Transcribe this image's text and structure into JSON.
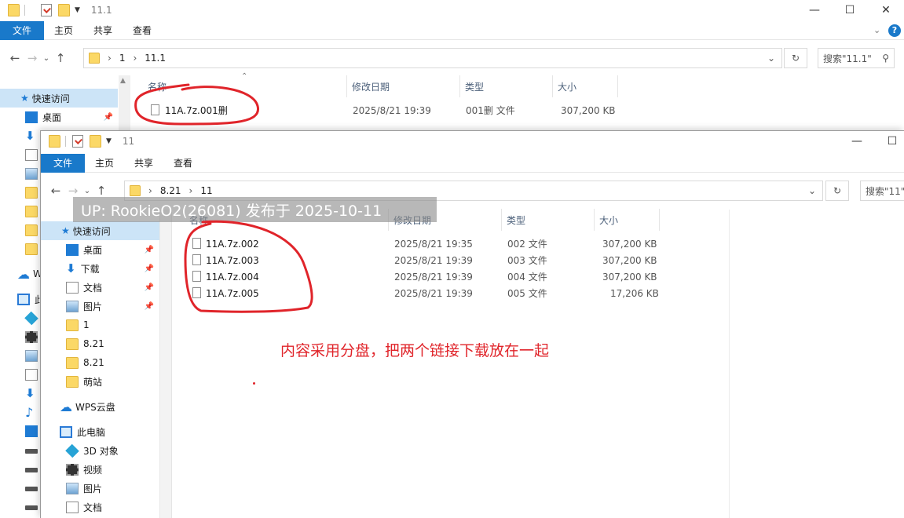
{
  "back_window": {
    "title": "11.1",
    "ribbon_tabs": [
      "文件",
      "主页",
      "共享",
      "查看"
    ],
    "path": [
      "1",
      "11.1"
    ],
    "search_placeholder": "搜索\"11.1\"",
    "columns": {
      "name": "名称",
      "modified": "修改日期",
      "type": "类型",
      "size": "大小"
    },
    "files": [
      {
        "name": "11A.7z.001删",
        "modified": "2025/8/21 19:39",
        "type": "001删 文件",
        "size": "307,200 KB"
      }
    ],
    "sidebar": {
      "quick_access": "快速访问",
      "desktop": "桌面",
      "wps": "W",
      "this_pc": "此"
    }
  },
  "front_window": {
    "title": "11",
    "ribbon_tabs": [
      "文件",
      "主页",
      "共享",
      "查看"
    ],
    "path": [
      "8.21",
      "11"
    ],
    "search_placeholder": "搜索\"11\"",
    "columns": {
      "name": "名称",
      "modified": "修改日期",
      "type": "类型",
      "size": "大小"
    },
    "files": [
      {
        "name": "11A.7z.002",
        "modified": "2025/8/21 19:35",
        "type": "002 文件",
        "size": "307,200 KB"
      },
      {
        "name": "11A.7z.003",
        "modified": "2025/8/21 19:39",
        "type": "003 文件",
        "size": "307,200 KB"
      },
      {
        "name": "11A.7z.004",
        "modified": "2025/8/21 19:39",
        "type": "004 文件",
        "size": "307,200 KB"
      },
      {
        "name": "11A.7z.005",
        "modified": "2025/8/21 19:39",
        "type": "005 文件",
        "size": "17,206 KB"
      }
    ],
    "sidebar": {
      "quick_access": "快速访问",
      "items": [
        "桌面",
        "下载",
        "文档",
        "图片",
        "1",
        "8.21",
        "8.21",
        "萌站"
      ],
      "wps": "WPS云盘",
      "this_pc": "此电脑",
      "pc_items": [
        "3D 对象",
        "视频",
        "图片",
        "文档"
      ]
    }
  },
  "overlay": {
    "watermark": "UP: RookieO2(26081) 发布于 2025-10-11",
    "note": "内容采用分盘，把两个链接下载放在一起"
  },
  "colors": {
    "annotation_red": "#e0242a",
    "file_tab_blue": "#1979ca",
    "folder_yellow": "#fbd866"
  },
  "icons": [
    "folder-icon",
    "properties-icon",
    "minimize-icon",
    "maximize-icon",
    "close-icon",
    "help-icon",
    "back-icon",
    "forward-icon",
    "up-icon",
    "refresh-icon",
    "search-icon",
    "pin-icon",
    "file-icon"
  ]
}
